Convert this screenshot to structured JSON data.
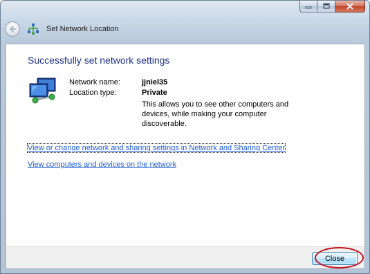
{
  "window": {
    "title": "Set Network Location"
  },
  "icons": {
    "back": "back-arrow-icon",
    "network": "network-icon",
    "computer": "network-computers-icon",
    "minimize": "minimize-icon",
    "maximize": "maximize-icon",
    "close": "close-icon"
  },
  "main": {
    "heading": "Successfully set network settings",
    "network_name_label": "Network name:",
    "network_name_value": "jjniel35",
    "location_type_label": "Location type:",
    "location_type_value": "Private",
    "description": "This allows you to see other computers and devices, while making your computer discoverable.",
    "link_sharing_center": "View or change network and sharing settings in Network and Sharing Center",
    "link_view_computers": "View computers and devices on the network"
  },
  "footer": {
    "close_label": "Close"
  },
  "colors": {
    "heading": "#1e3287",
    "link": "#1b5cd6",
    "annotation": "#c4121c"
  }
}
